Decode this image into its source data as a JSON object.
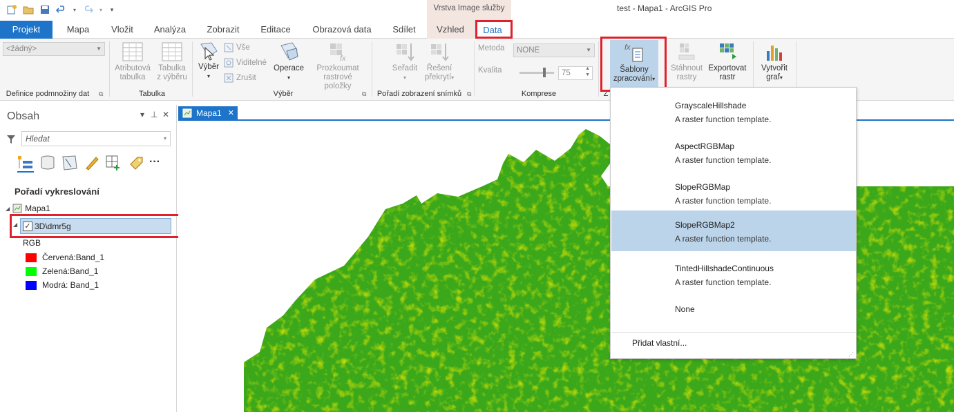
{
  "window": {
    "title": "test - Mapa1 - ArcGIS Pro",
    "context_header": "Vrstva Image služby"
  },
  "tabs": [
    {
      "label": "Projekt"
    },
    {
      "label": "Mapa"
    },
    {
      "label": "Vložit"
    },
    {
      "label": "Analýza"
    },
    {
      "label": "Zobrazit"
    },
    {
      "label": "Editace"
    },
    {
      "label": "Obrazová data"
    },
    {
      "label": "Sdílet"
    },
    {
      "label": "Vzhled"
    },
    {
      "label": "Data"
    }
  ],
  "ribbon": {
    "definition_combo": "<žádný>",
    "groups": {
      "definition": "Definice podmnožiny dat",
      "table": "Tabulka",
      "selection": "Výběr",
      "order": "Pořadí zobrazení snímků",
      "compression": "Komprese",
      "partial": "Z"
    },
    "attr_table_1": "Atributová",
    "attr_table_2": "tabulka",
    "sel_table_1": "Tabulka",
    "sel_table_2": "z výběru",
    "select": "Výběr",
    "all": "Vše",
    "visible": "Viditelné",
    "clear": "Zrušit",
    "operations": "Operace",
    "explore_1": "Prozkoumat",
    "explore_2": "rastrové položky",
    "sort": "Seřadit",
    "overlap_1": "Řešení",
    "overlap_2": "překrytí",
    "method_label": "Metoda",
    "method_value": "NONE",
    "quality_label": "Kvalita",
    "quality_value": "75",
    "templates_1": "Šablony",
    "templates_2": "zpracování",
    "download_1": "Stáhnout",
    "download_2": "rastry",
    "export_1": "Exportovat",
    "export_2": "rastr",
    "chart_1": "Vytvořit",
    "chart_2": "graf"
  },
  "contents": {
    "title": "Obsah",
    "search_placeholder": "Hledat",
    "drawing_order": "Pořadí vykreslování",
    "map_name": "Mapa1",
    "layer_name": "3D\\dmr5g",
    "rgb_label": "RGB",
    "legend": [
      {
        "label": "Červená:Band_1",
        "color": "#ff0000"
      },
      {
        "label": "Zelená:Band_1",
        "color": "#00ff00"
      },
      {
        "label": "Modrá: Band_1",
        "color": "#0000ff"
      }
    ]
  },
  "map_view": {
    "tab_label": "Mapa1"
  },
  "templates_dropdown": {
    "items": [
      {
        "name": "GrayscaleHillshade",
        "description": "A raster function template."
      },
      {
        "name": "AspectRGBMap",
        "description": "A raster function template."
      },
      {
        "name": "SlopeRGBMap",
        "description": "A raster function template."
      },
      {
        "name": "SlopeRGBMap2",
        "description": "A raster function template."
      },
      {
        "name": "TintedHillshadeContinuous",
        "description": "A raster function template."
      },
      {
        "name": "None",
        "description": ""
      }
    ],
    "add_custom": "Přidat vlastní..."
  }
}
